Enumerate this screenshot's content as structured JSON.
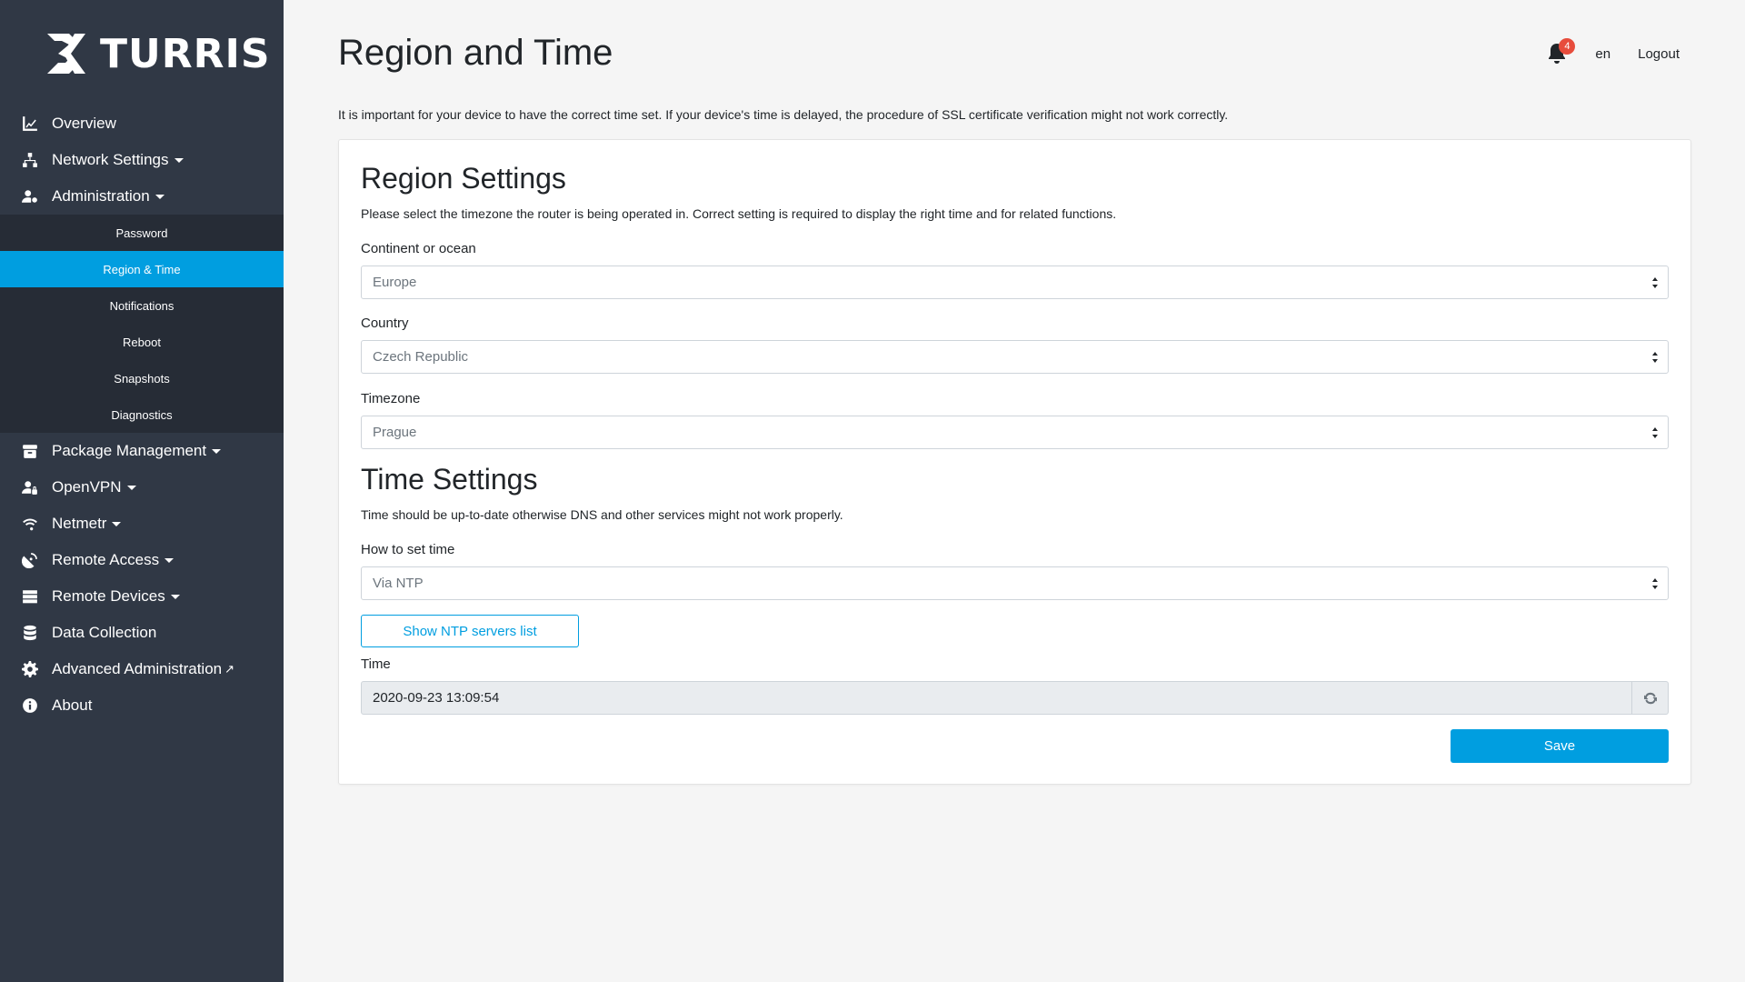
{
  "brand": {
    "name": "TURRIS"
  },
  "sidebar": {
    "items": [
      {
        "label": "Overview",
        "icon": "chart-line-icon",
        "caret": false
      },
      {
        "label": "Network Settings",
        "icon": "network-icon",
        "caret": true
      },
      {
        "label": "Administration",
        "icon": "user-cog-icon",
        "caret": true
      }
    ],
    "subitems": [
      {
        "label": "Password",
        "active": false
      },
      {
        "label": "Region & Time",
        "active": true
      },
      {
        "label": "Notifications",
        "active": false
      },
      {
        "label": "Reboot",
        "active": false
      },
      {
        "label": "Snapshots",
        "active": false
      },
      {
        "label": "Diagnostics",
        "active": false
      }
    ],
    "items_after": [
      {
        "label": "Package Management",
        "icon": "box-icon",
        "caret": true
      },
      {
        "label": "OpenVPN",
        "icon": "user-lock-icon",
        "caret": true
      },
      {
        "label": "Netmetr",
        "icon": "wifi-icon",
        "caret": true
      },
      {
        "label": "Remote Access",
        "icon": "satellite-dish-icon",
        "caret": true
      },
      {
        "label": "Remote Devices",
        "icon": "server-icon",
        "caret": true
      },
      {
        "label": "Data Collection",
        "icon": "database-icon",
        "caret": false
      },
      {
        "label": "Advanced Administration",
        "icon": "gear-icon",
        "caret": false,
        "external": true
      },
      {
        "label": "About",
        "icon": "info-circle-icon",
        "caret": false
      }
    ]
  },
  "header": {
    "title": "Region and Time",
    "notifications_count": "4",
    "language": "en",
    "logout_label": "Logout"
  },
  "intro_text": "It is important for your device to have the correct time set. If your device's time is delayed, the procedure of SSL certificate verification might not work correctly.",
  "region": {
    "title": "Region Settings",
    "description": "Please select the timezone the router is being operated in. Correct setting is required to display the right time and for related functions.",
    "continent_label": "Continent or ocean",
    "continent_value": "Europe",
    "country_label": "Country",
    "country_value": "Czech Republic",
    "timezone_label": "Timezone",
    "timezone_value": "Prague"
  },
  "time": {
    "title": "Time Settings",
    "description": "Time should be up-to-date otherwise DNS and other services might not work properly.",
    "method_label": "How to set time",
    "method_value": "Via NTP",
    "ntp_button_label": "Show NTP servers list",
    "time_label": "Time",
    "time_value": "2020-09-23 13:09:54",
    "save_label": "Save"
  },
  "colors": {
    "sidebar_bg": "#303845",
    "subnav_bg": "#262c36",
    "accent": "#009ee0",
    "badge": "#e74c3c"
  }
}
